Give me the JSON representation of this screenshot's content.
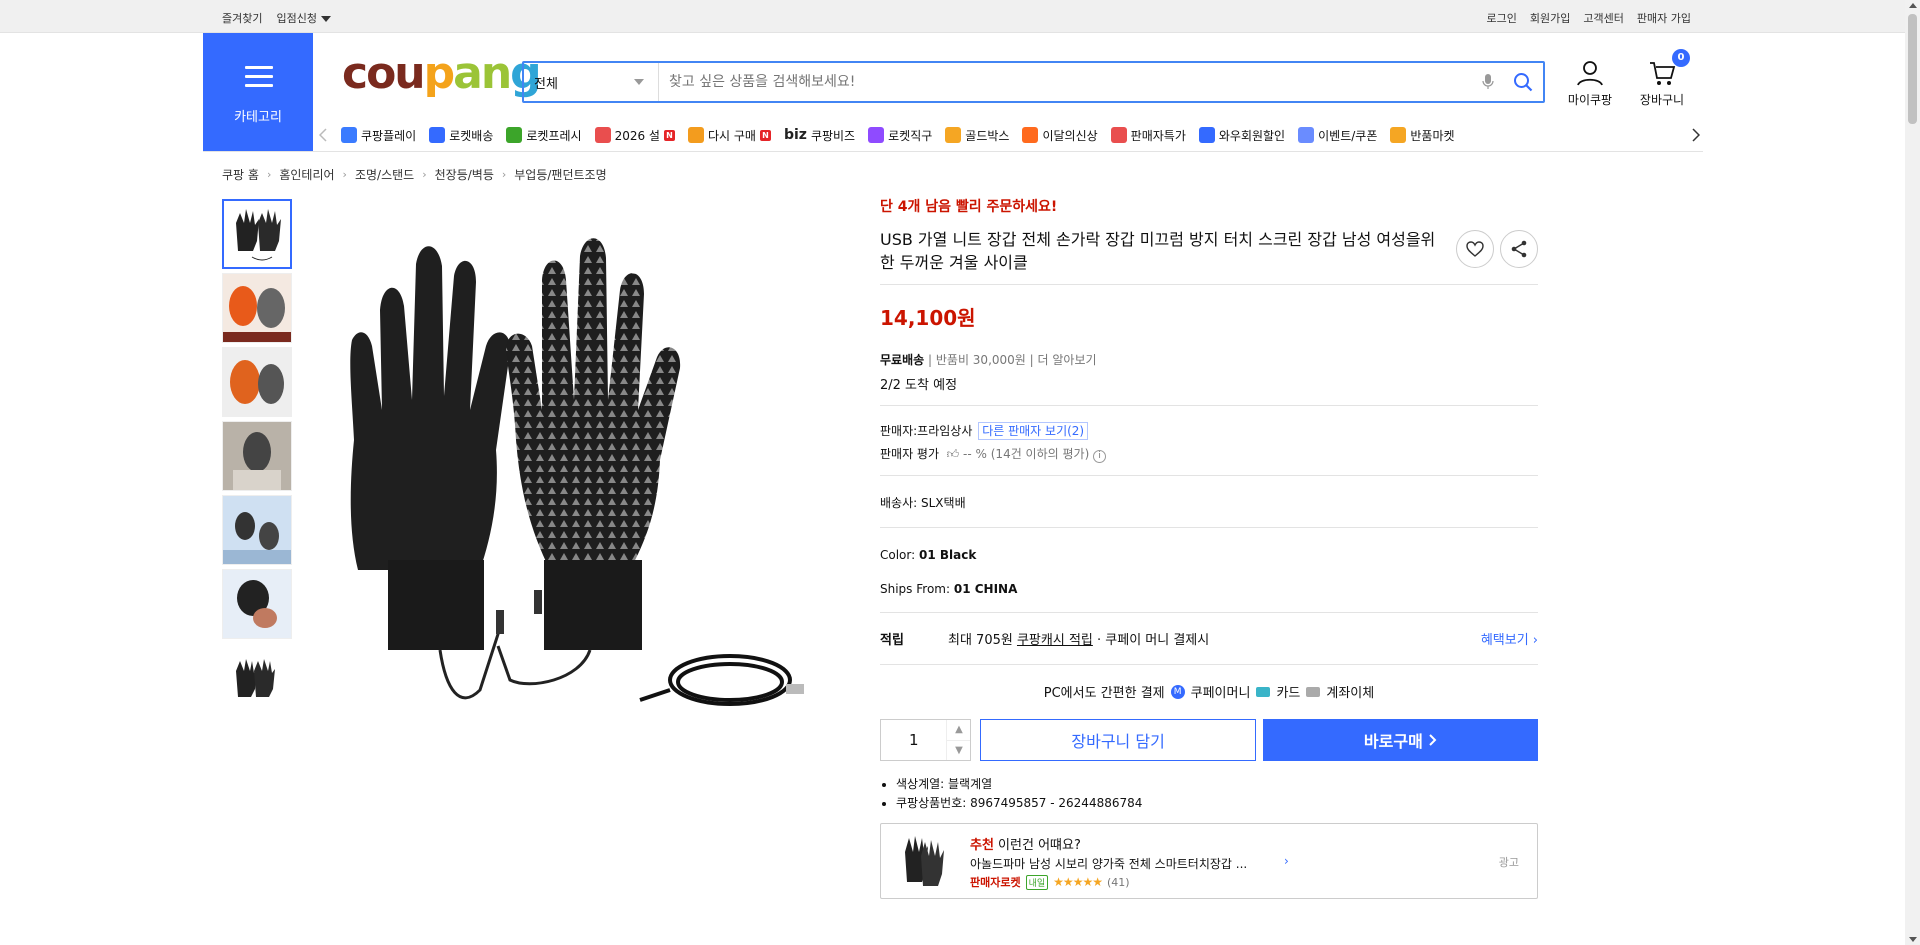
{
  "topbar": {
    "left": [
      "즐겨찾기",
      "입점신청"
    ],
    "right": [
      "로그인",
      "회원가입",
      "고객센터",
      "판매자 가입"
    ]
  },
  "header": {
    "category_label": "카테고리",
    "logo": {
      "c1": "cou",
      "c2": "p",
      "c3": "an",
      "c4": "g"
    },
    "search": {
      "category": "전체",
      "placeholder": "찾고 싶은 상품을 검색해보세요!"
    },
    "mycoupang": "마이쿠팡",
    "cart": "장바구니",
    "cart_count": "0"
  },
  "nav": {
    "items": [
      {
        "label": "쿠팡플레이",
        "icon": "play-icon",
        "color": "#3a7bff"
      },
      {
        "label": "로켓배송",
        "icon": "rocket-icon",
        "color": "#346aff"
      },
      {
        "label": "로켓프레시",
        "icon": "fresh-icon",
        "color": "#3ca52a"
      },
      {
        "label": "2026 설",
        "icon": "gift-icon",
        "color": "#e94e4e",
        "badge": "N"
      },
      {
        "label": "다시 구매",
        "icon": "rebuy-icon",
        "color": "#f39c1e",
        "badge": "N"
      },
      {
        "label": "쿠팡비즈",
        "icon": "biz-icon",
        "color": "#346aff",
        "prefix": "biz"
      },
      {
        "label": "로켓직구",
        "icon": "global-icon",
        "color": "#8f4bff"
      },
      {
        "label": "골드박스",
        "icon": "goldbox-icon",
        "color": "#f5a623"
      },
      {
        "label": "이달의신상",
        "icon": "new-icon",
        "color": "#ff6a1e"
      },
      {
        "label": "판매자특가",
        "icon": "sale-icon",
        "color": "#e94e4e"
      },
      {
        "label": "와우회원할인",
        "icon": "wow-icon",
        "color": "#346aff"
      },
      {
        "label": "이벤트/쿠폰",
        "icon": "coupon-icon",
        "color": "#6a8cff"
      },
      {
        "label": "반품마켓",
        "icon": "return-icon",
        "color": "#f5a623"
      }
    ]
  },
  "breadcrumb": [
    "쿠팡 홈",
    "홈인테리어",
    "조명/스탠드",
    "천장등/벽등",
    "부업등/팬던트조명"
  ],
  "product": {
    "stock_alert": "단 4개 남음 빨리 주문하세요!",
    "title": "USB 가열 니트 장갑 전체 손가락 장갑 미끄럼 방지 터치 스크린 장갑 남성 여성을위한 두꺼운 겨울 사이클",
    "price": "14,100원",
    "shipping": {
      "free": "무료배송",
      "return_fee": "반품비 30,000원",
      "more": "더 알아보기",
      "arrival": "2/2 도착 예정"
    },
    "seller": {
      "label": "판매자:",
      "name": "프라임상사",
      "others": "다른 판매자 보기(2)",
      "rating_label": "판매자 평가",
      "rating_value": "-- %",
      "rating_note": "(14건 이하의 평가)"
    },
    "carrier": {
      "label": "배송사:",
      "name": "SLX택배"
    },
    "color": {
      "label": "Color:",
      "value": "01 Black"
    },
    "ships_from": {
      "label": "Ships From:",
      "value": "01 CHINA"
    },
    "points": {
      "label": "적립",
      "text": "최대 705원",
      "cash": "쿠팡캐시 적립",
      "tail": "· 쿠페이 머니 결제시",
      "benefit": "혜택보기"
    },
    "pay": {
      "title": "PC에서도 간편한 결제",
      "options": [
        "쿠페이머니",
        "카드",
        "계좌이체"
      ]
    },
    "quantity": "1",
    "cart_btn": "장바구니 담기",
    "buy_btn": "바로구매",
    "details": [
      "색상계열: 블랙계열",
      "쿠팡상품번호: 8967495857 - 26244886784"
    ]
  },
  "recommend": {
    "head_red": "추천",
    "head_rest": " 이런건 어떄요?",
    "item": "아놀드파마 남성 시보리 양가죽 전체 스마트터치장갑 ...",
    "tag": "판매자로켓",
    "tag2": "내일",
    "stars": "★★★★★",
    "reviews": "(41)",
    "ad": "광고"
  },
  "colors": {
    "accent": "#346aff",
    "price": "#cb1400"
  }
}
